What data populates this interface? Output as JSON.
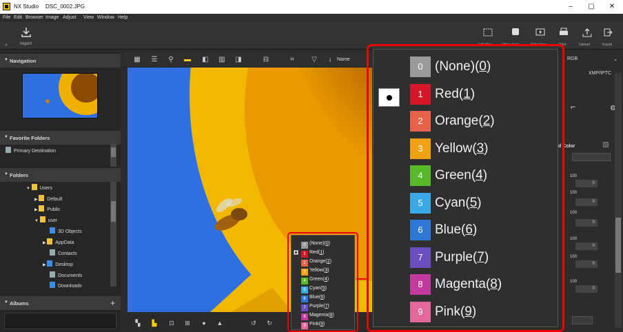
{
  "app": {
    "name": "NX Studio",
    "document": "DSC_0002.JPG"
  },
  "menu": [
    "File",
    "Edit",
    "Browser",
    "Image",
    "Adjust",
    "View",
    "Window",
    "Help"
  ],
  "toolbar": {
    "import_label": "Import",
    "right_tools": [
      "Edit Map",
      "Other Apps",
      "Slideshow",
      "Print",
      "Upload",
      "Export"
    ]
  },
  "left_panel": {
    "navigation": "Navigation",
    "favorite_folders": "Favorite Folders",
    "favorites": [
      "Primary Destination"
    ],
    "folders": "Folders",
    "tree": [
      "Users",
      "Default",
      "Public",
      "user",
      "3D Objects",
      "AppData",
      "Contacts",
      "Desktop",
      "Documents",
      "Downloads"
    ],
    "albums": "Albums",
    "albums_add": "+"
  },
  "main": {
    "sort_label": "Name"
  },
  "right_panel": {
    "color_space": "RGB",
    "tab_xmp": "XMP/IPTC",
    "band_color_label": "d Color",
    "slider_labels": [
      "100",
      "100",
      "100",
      "100",
      "100",
      "100"
    ],
    "slider_values": [
      "0",
      "0",
      "0",
      "0",
      "0",
      "0"
    ]
  },
  "label_menu": {
    "selected_index": 1,
    "items": [
      {
        "num": "0",
        "name": "(None)",
        "key": "0",
        "color": "#9a9a9a"
      },
      {
        "num": "1",
        "name": "Red",
        "key": "1",
        "color": "#d4182a"
      },
      {
        "num": "2",
        "name": "Orange",
        "key": "2",
        "color": "#e8624a"
      },
      {
        "num": "3",
        "name": "Yellow",
        "key": "3",
        "color": "#f2a112"
      },
      {
        "num": "4",
        "name": "Green",
        "key": "4",
        "color": "#5ab92a"
      },
      {
        "num": "5",
        "name": "Cyan",
        "key": "5",
        "color": "#3aa9e6"
      },
      {
        "num": "6",
        "name": "Blue",
        "key": "6",
        "color": "#2f78d6"
      },
      {
        "num": "7",
        "name": "Purple",
        "key": "7",
        "color": "#6b4fc0"
      },
      {
        "num": "8",
        "name": "Magenta",
        "key": "8",
        "color": "#c23a9e"
      },
      {
        "num": "9",
        "name": "Pink",
        "key": "9",
        "color": "#e2679a"
      }
    ]
  }
}
